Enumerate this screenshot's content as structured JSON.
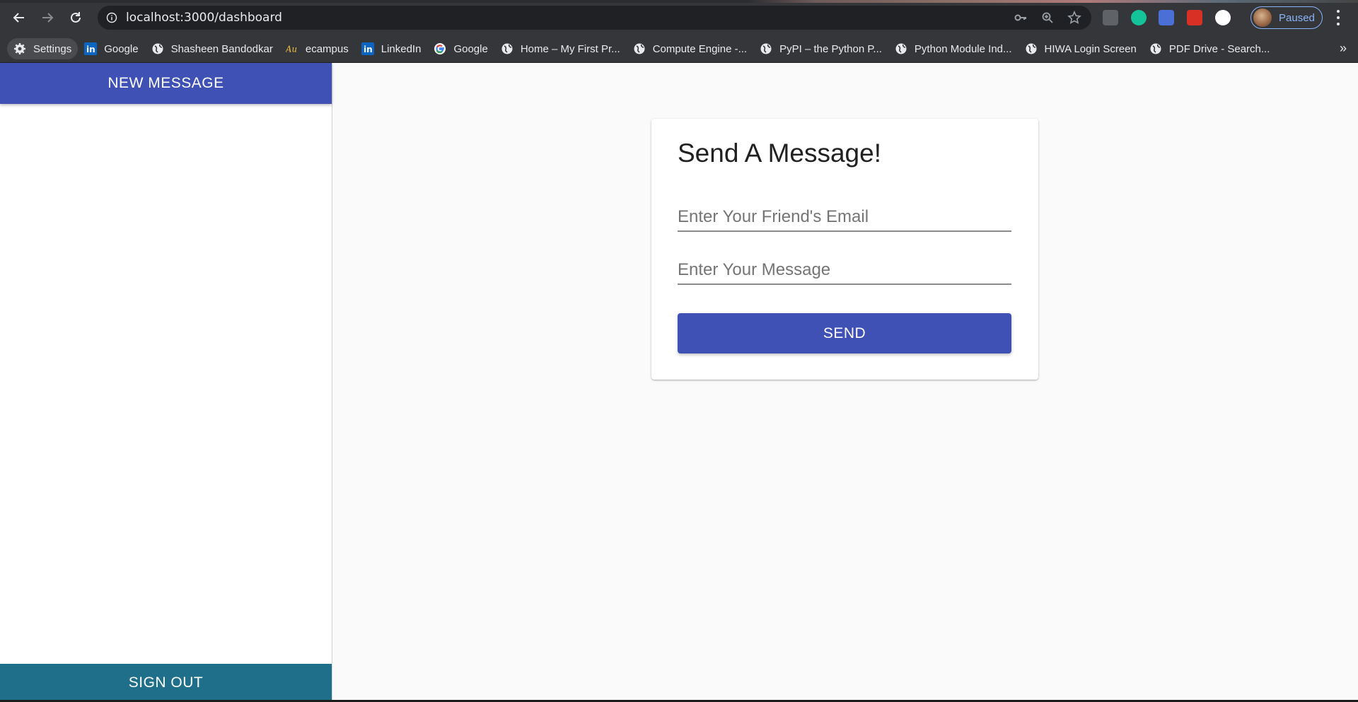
{
  "browser": {
    "url": "localhost:3000/dashboard",
    "profile_status": "Paused",
    "bookmarks": [
      {
        "label": "Settings",
        "icon": "gear-icon"
      },
      {
        "label": "Google",
        "icon": "linkedin-icon"
      },
      {
        "label": "Shasheen Bandodkar",
        "icon": "globe-icon"
      },
      {
        "label": "ecampus",
        "icon": "au-icon"
      },
      {
        "label": "LinkedIn",
        "icon": "linkedin-icon"
      },
      {
        "label": "Google",
        "icon": "google-icon"
      },
      {
        "label": "Home – My First Pr...",
        "icon": "globe-icon"
      },
      {
        "label": "Compute Engine -...",
        "icon": "globe-icon"
      },
      {
        "label": "PyPI – the Python P...",
        "icon": "globe-icon"
      },
      {
        "label": "Python Module Ind...",
        "icon": "globe-icon"
      },
      {
        "label": "HIWA Login Screen",
        "icon": "globe-icon"
      },
      {
        "label": "PDF Drive - Search...",
        "icon": "globe-icon"
      }
    ],
    "more_label": "»"
  },
  "sidebar": {
    "new_message_label": "NEW MESSAGE",
    "sign_out_label": "SIGN OUT"
  },
  "card": {
    "title": "Send A Message!",
    "email_placeholder": "Enter Your Friend's Email",
    "message_placeholder": "Enter Your Message",
    "send_label": "SEND"
  },
  "colors": {
    "primary": "#3f51b5",
    "sign_out": "#1f6f8b",
    "page_bg": "#fafafa"
  }
}
